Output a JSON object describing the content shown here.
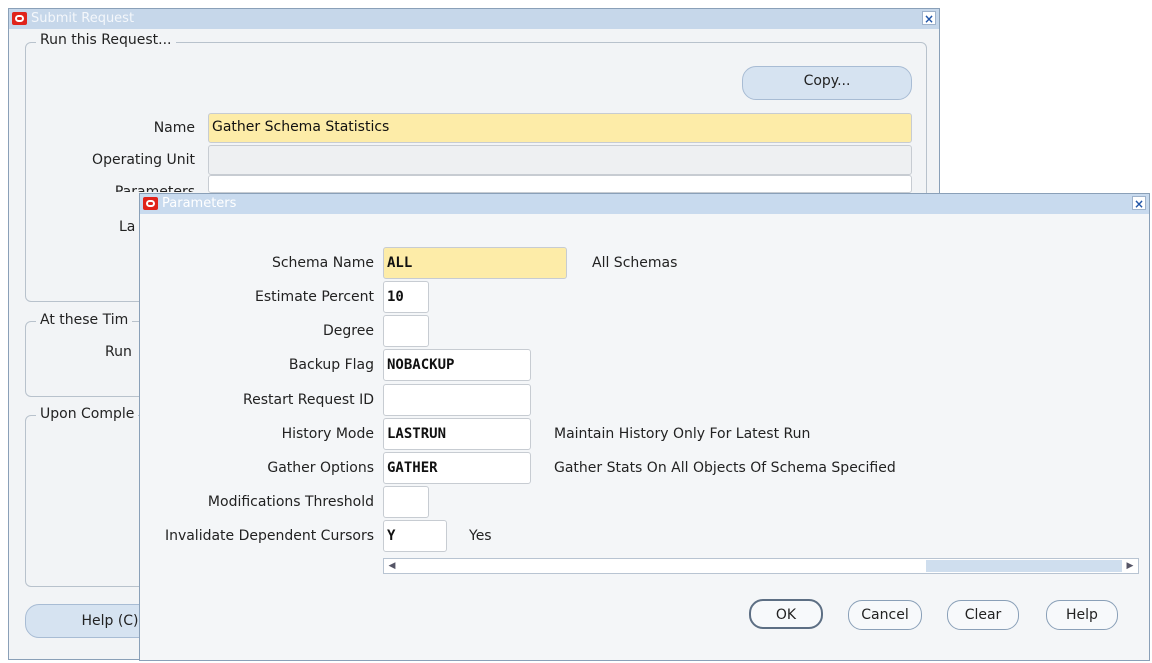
{
  "submit_request": {
    "title": "Submit Request",
    "close": "×",
    "run_group_label": "Run this Request...",
    "copy_label": "Copy...",
    "name_label": "Name",
    "name_value": "Gather Schema Statistics",
    "operating_unit_label": "Operating Unit",
    "operating_unit_value": "",
    "parameters_label": "Parameters",
    "language_label": "La",
    "times_group_label": "At these Tim",
    "run_label": "Run",
    "completion_group_label": "Upon Comple",
    "help_label": "Help (C)"
  },
  "parameters": {
    "title": "Parameters",
    "close": "×",
    "rows": [
      {
        "label": "Schema Name",
        "value": "ALL",
        "desc": "All Schemas"
      },
      {
        "label": "Estimate Percent",
        "value": "10",
        "desc": ""
      },
      {
        "label": "Degree",
        "value": "",
        "desc": ""
      },
      {
        "label": "Backup Flag",
        "value": "NOBACKUP",
        "desc": ""
      },
      {
        "label": "Restart Request ID",
        "value": "",
        "desc": ""
      },
      {
        "label": "History Mode",
        "value": "LASTRUN",
        "desc": "Maintain History Only For Latest Run"
      },
      {
        "label": "Gather Options",
        "value": "GATHER",
        "desc": "Gather Stats On All Objects Of Schema Specified"
      },
      {
        "label": "Modifications Threshold",
        "value": "",
        "desc": ""
      },
      {
        "label": "Invalidate Dependent Cursors",
        "value": "Y",
        "desc": "Yes"
      }
    ],
    "buttons": {
      "ok": "OK",
      "cancel": "Cancel",
      "clear": "Clear",
      "help": "Help"
    }
  },
  "colors": {
    "field_required": "#fdeca8",
    "titlebar": "#c8daee",
    "button_fill": "#d6e3f1"
  }
}
